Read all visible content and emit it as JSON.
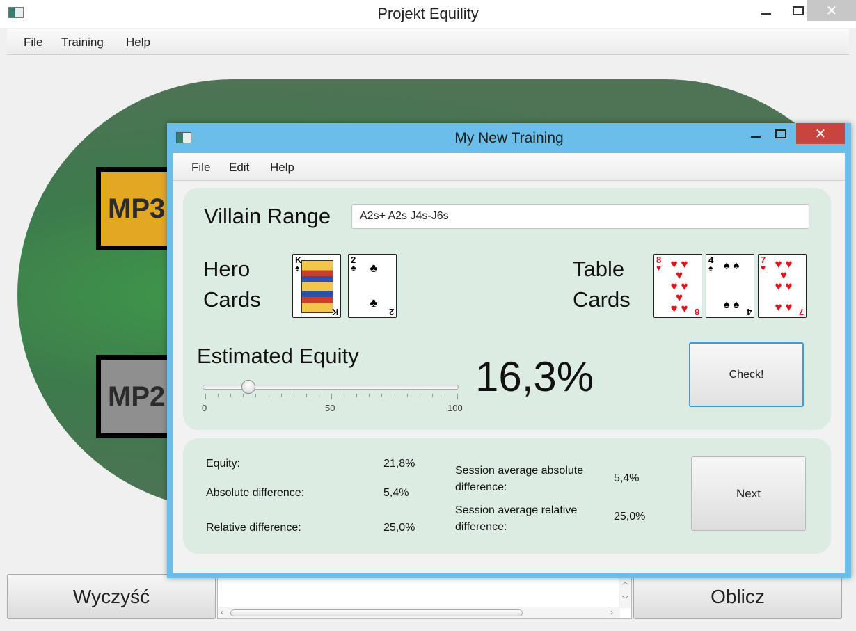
{
  "outer": {
    "title": "Projekt Equility",
    "close_glyph": "✕",
    "menu": [
      "File",
      "Training",
      "Help"
    ],
    "seats": [
      {
        "label": "MP3",
        "color": "#e2a822"
      },
      {
        "label": "MP2",
        "color": "#8f8f8f"
      }
    ],
    "clear_button": "Wyczyść",
    "calc_button": "Oblicz"
  },
  "dialog": {
    "title": "My New Training",
    "close_glyph": "✕",
    "menu": [
      "File",
      "Edit",
      "Help"
    ],
    "villain_range_label": "Villain Range",
    "villain_range_value": "A2s+ A2s J4s-J6s",
    "hero_label": [
      "Hero",
      "Cards"
    ],
    "table_label": [
      "Table",
      "Cards"
    ],
    "hero_cards": [
      {
        "rank": "K",
        "suit": "♠",
        "color": "black"
      },
      {
        "rank": "2",
        "suit": "♣",
        "color": "black"
      }
    ],
    "table_cards": [
      {
        "rank": "8",
        "suit": "♥",
        "color": "red"
      },
      {
        "rank": "4",
        "suit": "♠",
        "color": "black"
      },
      {
        "rank": "7",
        "suit": "♥",
        "color": "red"
      }
    ],
    "estimated_equity_label": "Estimated Equity",
    "estimated_equity_value": "16,3%",
    "slider": {
      "min": "0",
      "mid": "50",
      "max": "100",
      "value": 17
    },
    "check_button": "Check!",
    "next_button": "Next",
    "results": {
      "equity_label": "Equity:",
      "equity_value": "21,8%",
      "abs_diff_label": "Absolute difference:",
      "abs_diff_value": "5,4%",
      "rel_diff_label": "Relative difference:",
      "rel_diff_value": "25,0%",
      "session_abs_label_1": "Session average absolute",
      "session_abs_label_2": "difference:",
      "session_abs_value": "5,4%",
      "session_rel_label_1": "Session average relative",
      "session_rel_label_2": "difference:",
      "session_rel_value": "25,0%"
    }
  }
}
